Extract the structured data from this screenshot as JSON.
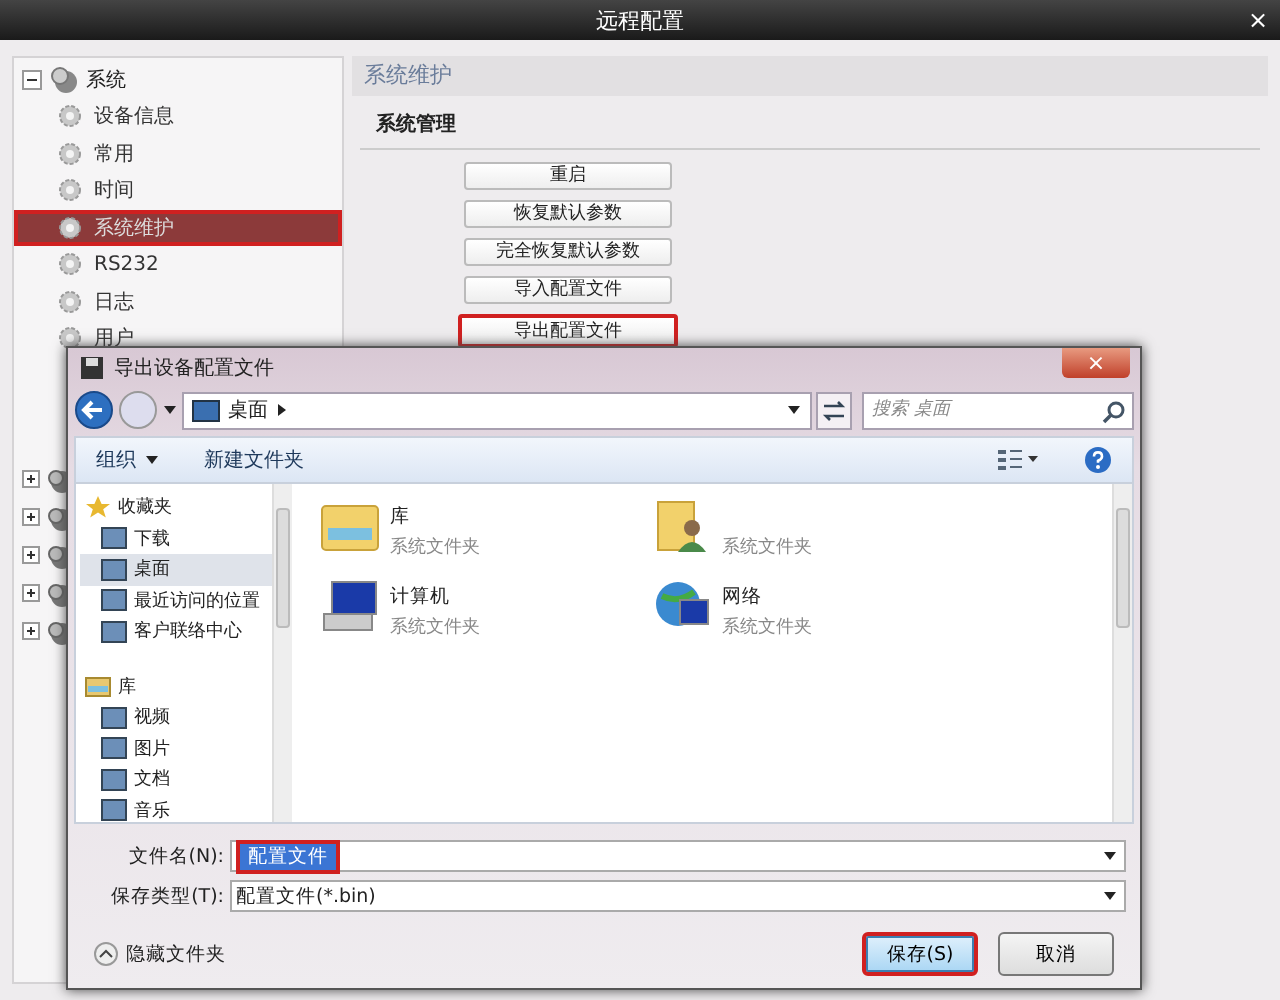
{
  "window": {
    "title": "远程配置",
    "close": "×"
  },
  "sidebar": {
    "tree": {
      "label": "系统",
      "expanded": true,
      "children": [
        {
          "label": "设备信息",
          "selected": false,
          "highlighted": false
        },
        {
          "label": "常用",
          "selected": false,
          "highlighted": false
        },
        {
          "label": "时间",
          "selected": false,
          "highlighted": false
        },
        {
          "label": "系统维护",
          "selected": true,
          "highlighted": true
        },
        {
          "label": "RS232",
          "selected": false,
          "highlighted": false
        },
        {
          "label": "日志",
          "selected": false,
          "highlighted": false
        },
        {
          "label": "用户",
          "selected": false,
          "highlighted": false
        }
      ]
    },
    "other_nodes": [
      {
        "expanded": false
      },
      {
        "expanded": false
      },
      {
        "expanded": false
      },
      {
        "expanded": false
      },
      {
        "expanded": false
      }
    ]
  },
  "panel": {
    "title": "系统维护",
    "section": "系统管理",
    "buttons": [
      {
        "label": "重启",
        "highlighted": false
      },
      {
        "label": "恢复默认参数",
        "highlighted": false
      },
      {
        "label": "完全恢复默认参数",
        "highlighted": false
      },
      {
        "label": "导入配置文件",
        "highlighted": false
      },
      {
        "label": "导出配置文件",
        "highlighted": true
      }
    ]
  },
  "dialog": {
    "title": "导出设备配置文件",
    "close": "×",
    "path": "桌面",
    "search": {
      "placeholder": "搜索 桌面"
    },
    "toolbar": [
      {
        "label": "组织",
        "dropdown": true
      },
      {
        "label": "新建文件夹",
        "dropdown": false
      }
    ],
    "nav": [
      {
        "kind": "favorites",
        "label": "收藏夹",
        "selected": false
      },
      {
        "kind": "item",
        "label": "下载",
        "selected": false
      },
      {
        "kind": "item",
        "label": "桌面",
        "selected": true
      },
      {
        "kind": "item",
        "label": "最近访问的位置",
        "selected": false
      },
      {
        "kind": "item",
        "label": "客户联络中心",
        "selected": false
      },
      {
        "kind": "libraries",
        "label": "库",
        "selected": false
      },
      {
        "kind": "item",
        "label": "视频",
        "selected": false
      },
      {
        "kind": "item",
        "label": "图片",
        "selected": false
      },
      {
        "kind": "item",
        "label": "文档",
        "selected": false
      },
      {
        "kind": "item",
        "label": "音乐",
        "selected": false
      }
    ],
    "items": [
      {
        "kind": "library",
        "name": "库",
        "subtitle": "系统文件夹"
      },
      {
        "kind": "user",
        "subtitle": "系统文件夹"
      },
      {
        "kind": "computer",
        "name": "计算机",
        "subtitle": "系统文件夹"
      },
      {
        "kind": "network",
        "name": "网络",
        "subtitle": "系统文件夹"
      }
    ],
    "filename": {
      "label": "文件名(N):",
      "value": "配置文件",
      "highlighted": true
    },
    "filetype": {
      "label": "保存类型(T):",
      "value": "配置文件(*.bin)"
    },
    "hide_folders": "隐藏文件夹",
    "buttons": [
      {
        "kind": "primary",
        "label": "保存(S)",
        "highlighted": true
      },
      {
        "kind": "normal",
        "label": "取消",
        "highlighted": false
      }
    ]
  }
}
